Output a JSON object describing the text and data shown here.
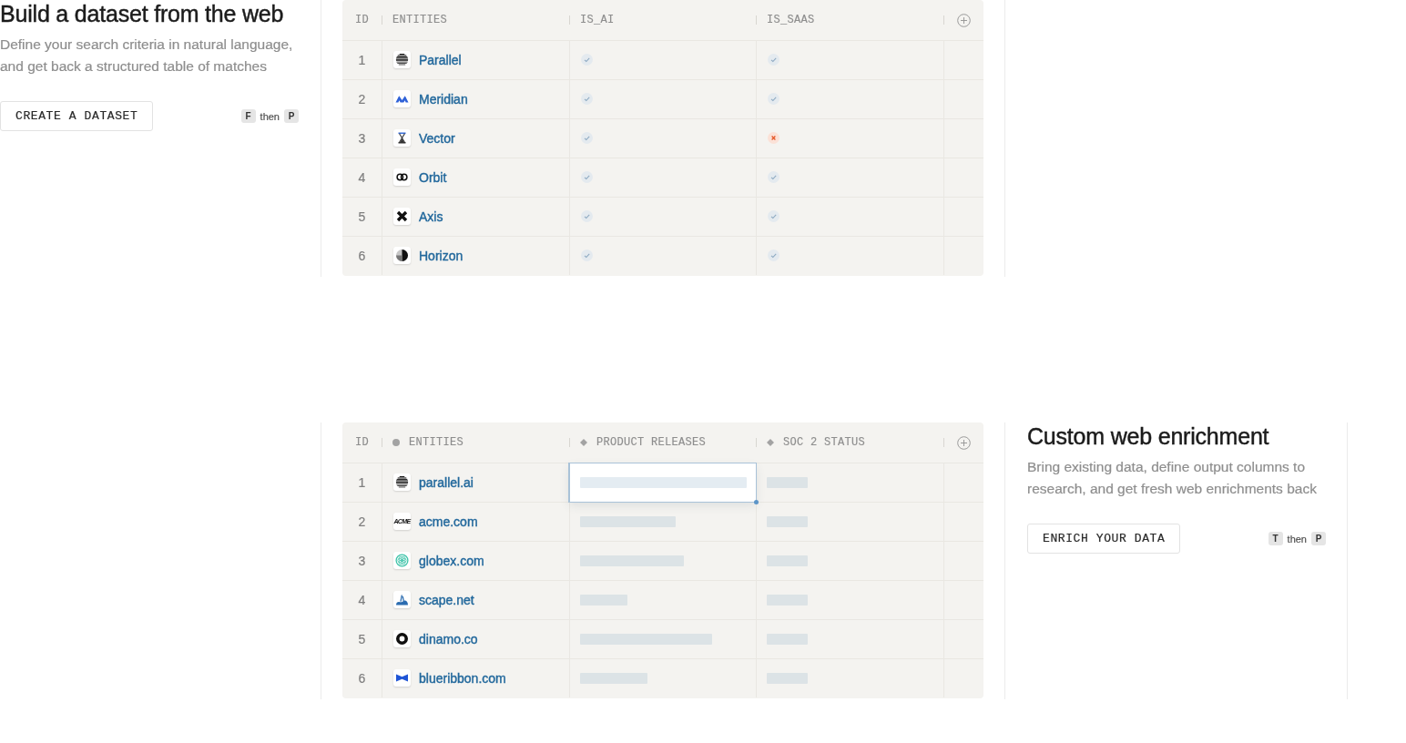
{
  "sections": [
    {
      "left_panel": {
        "title": "Build a dataset from the web",
        "description": "Define your search criteria in natural language, and get back a structured table of matches",
        "button": "CREATE A DATASET",
        "shortcut": [
          {
            "kind": "key",
            "text": "F"
          },
          {
            "kind": "word",
            "text": "then"
          },
          {
            "kind": "key",
            "text": "P"
          }
        ]
      },
      "table": {
        "columns": [
          {
            "label": "ID",
            "kind": "id"
          },
          {
            "label": "ENTITIES",
            "kind": "entity"
          },
          {
            "label": "IS_AI",
            "kind": "boolean"
          },
          {
            "label": "IS_SAAS",
            "kind": "boolean"
          }
        ],
        "rows": [
          {
            "id": "1",
            "entity": "Parallel",
            "cells": [
              {
                "match": true
              },
              {
                "match": true
              }
            ]
          },
          {
            "id": "2",
            "entity": "Meridian",
            "cells": [
              {
                "match": true
              },
              {
                "match": true
              }
            ]
          },
          {
            "id": "3",
            "entity": "Vector",
            "cells": [
              {
                "match": true
              },
              {
                "match": false
              }
            ]
          },
          {
            "id": "4",
            "entity": "Orbit",
            "cells": [
              {
                "match": true
              },
              {
                "match": true
              }
            ]
          },
          {
            "id": "5",
            "entity": "Axis",
            "cells": [
              {
                "match": true
              },
              {
                "match": true
              }
            ]
          },
          {
            "id": "6",
            "entity": "Horizon",
            "cells": [
              {
                "match": true
              },
              {
                "match": true
              }
            ]
          }
        ]
      }
    },
    {
      "table": {
        "columns": [
          {
            "label": "ID",
            "kind": "id"
          },
          {
            "label": "ENTITIES",
            "kind": "input"
          },
          {
            "label": "PRODUCT RELEASES",
            "kind": "output"
          },
          {
            "label": "SOC 2 STATUS",
            "kind": "output"
          }
        ],
        "rows": [
          {
            "id": "1",
            "entity": "parallel.ai",
            "cells": [
              {
                "loading": true,
                "selected": true
              },
              {
                "loading": true,
                "selected": false
              }
            ]
          },
          {
            "id": "2",
            "entity": "acme.com",
            "logo_text": "ACME",
            "cells": [
              {
                "loading": true,
                "selected": false
              },
              {
                "loading": true,
                "selected": false
              }
            ]
          },
          {
            "id": "3",
            "entity": "globex.com",
            "cells": [
              {
                "loading": true,
                "selected": false
              },
              {
                "loading": true,
                "selected": false
              }
            ]
          },
          {
            "id": "4",
            "entity": "scape.net",
            "cells": [
              {
                "loading": true,
                "selected": false
              },
              {
                "loading": true,
                "selected": false
              }
            ]
          },
          {
            "id": "5",
            "entity": "dinamo.co",
            "cells": [
              {
                "loading": true,
                "selected": false
              },
              {
                "loading": true,
                "selected": false
              }
            ]
          },
          {
            "id": "6",
            "entity": "blueribbon.com",
            "cells": [
              {
                "loading": true,
                "selected": false
              },
              {
                "loading": true,
                "selected": false
              }
            ]
          }
        ]
      },
      "right_panel": {
        "title": "Custom web enrichment",
        "description": "Bring existing data, define output columns to research, and get fresh web enrichments back",
        "button": "ENRICH YOUR DATA",
        "shortcut": [
          {
            "kind": "key",
            "text": "T"
          },
          {
            "kind": "word",
            "text": "then"
          },
          {
            "kind": "key",
            "text": "P"
          }
        ]
      }
    }
  ]
}
